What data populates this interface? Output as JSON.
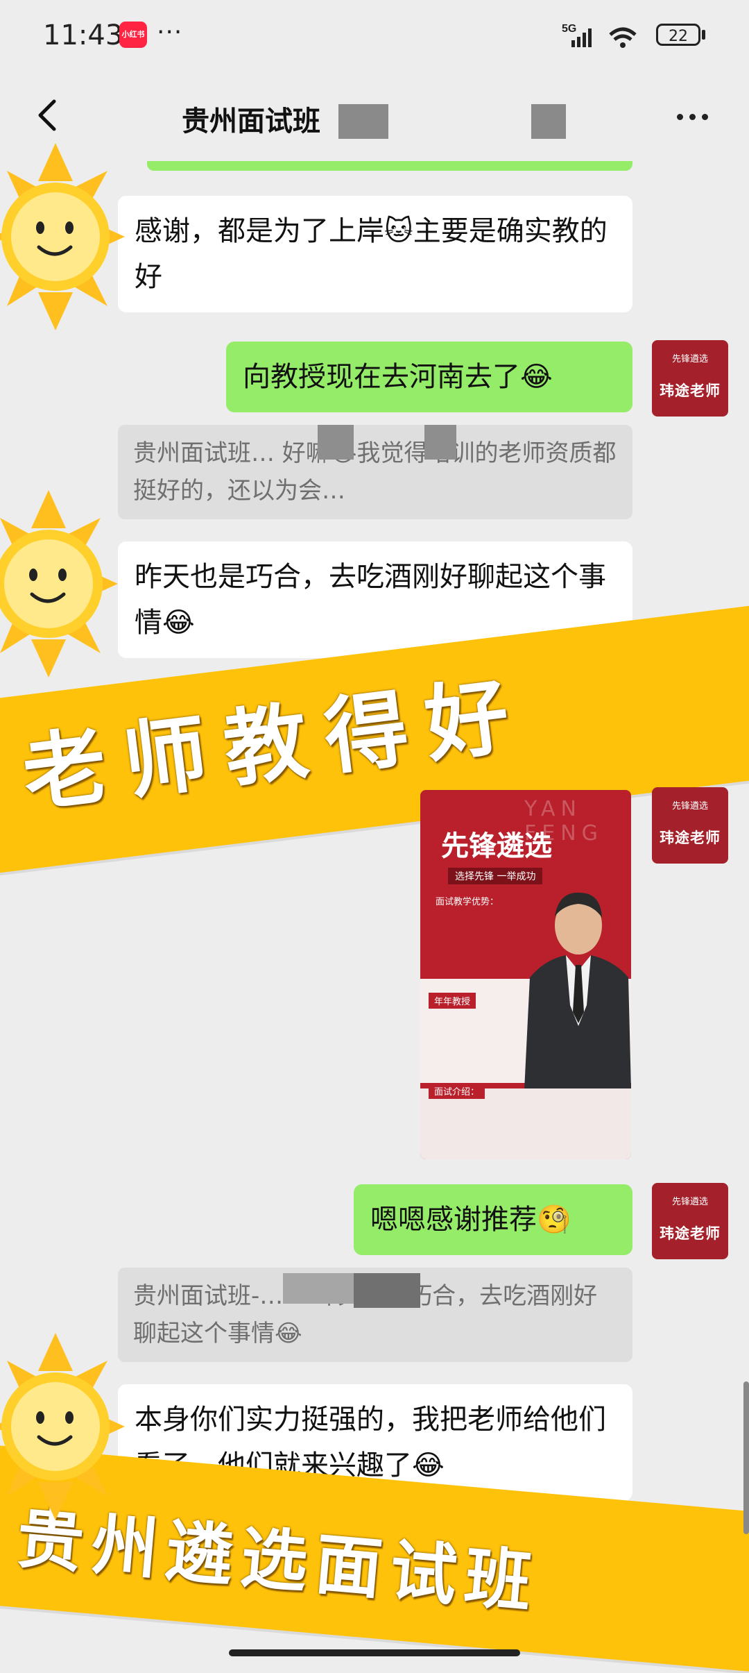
{
  "status": {
    "time": "11:43",
    "app_badge": "小红书",
    "more": "···",
    "network": "5G",
    "battery": "22"
  },
  "header": {
    "title": "贵州面试班"
  },
  "messages": [
    {
      "side": "left",
      "text": "感谢，都是为了上岸🐱主要是确实教的好"
    },
    {
      "side": "right",
      "text": "向教授现在去河南去了😂"
    },
    {
      "side": "quote",
      "text": "贵州面试班… 好嘛😭我觉得培训的老师资质都挺好的，还以为会…"
    },
    {
      "side": "left",
      "text": "昨天也是巧合，去吃酒刚好聊起这个事情😂"
    },
    {
      "side": "right",
      "text": "嗯嗯感谢推荐🧐"
    },
    {
      "side": "quote",
      "text": "贵州面试班-… ：昨天也是巧合，去吃酒刚好聊起这个事情😂"
    },
    {
      "side": "left",
      "text": "本身你们实力挺强的，我把老师给他们看了，他们就来兴趣了😂"
    }
  ],
  "avatar": {
    "small": "先锋遴选",
    "big": "玮途老师"
  },
  "poster": {
    "title": "先锋遴选",
    "bg_text": "YAN FENG",
    "slogan": "选择先锋 一举成功",
    "advantages_label": "面试教学优势：",
    "teacher_label": "年年教授",
    "intro_label": "面试介绍："
  },
  "banners": {
    "top": "老师教得好",
    "bottom": "贵州遴选面试班"
  },
  "colors": {
    "green_bubble": "#95ec69",
    "banner": "#ffc20a",
    "avatar": "#a4202a",
    "background": "#ededed"
  }
}
